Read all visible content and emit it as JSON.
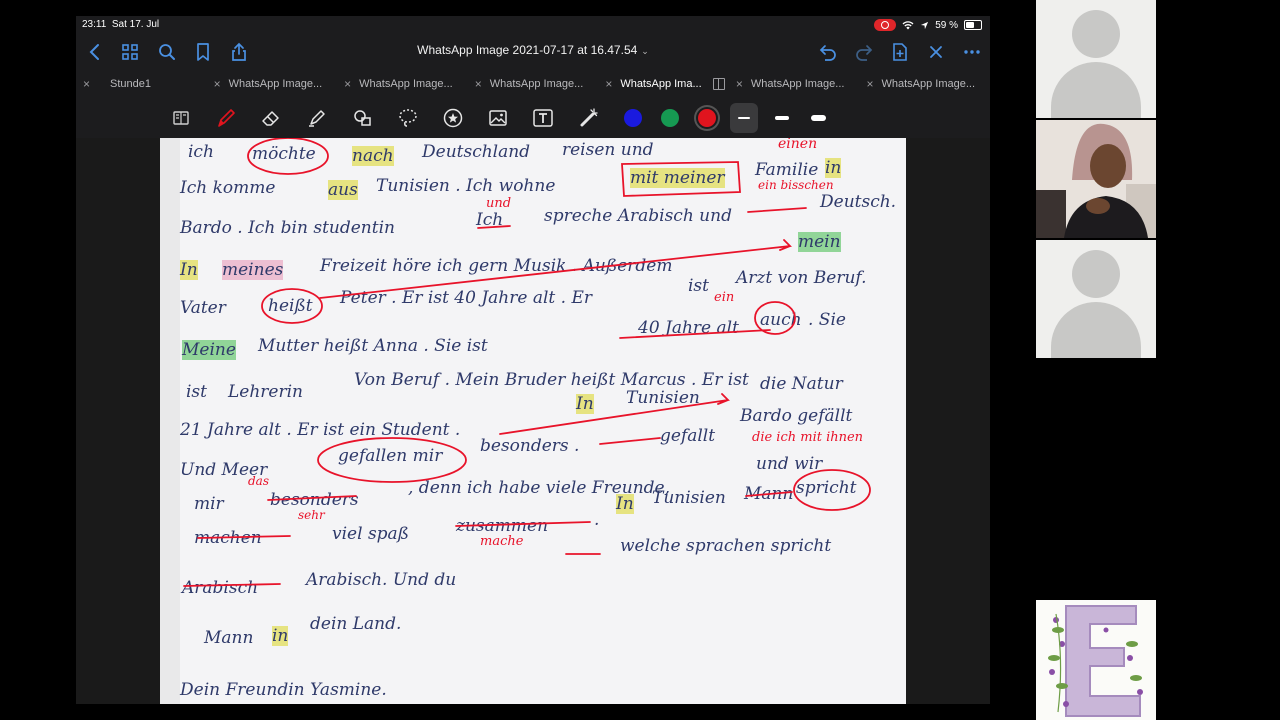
{
  "status_bar": {
    "time": "23:11",
    "date": "Sat 17. Jul",
    "battery": "59 %"
  },
  "navbar": {
    "title": "WhatsApp Image 2021-07-17 at 16.47.54"
  },
  "tabs": [
    {
      "label": "Stunde1",
      "active": false
    },
    {
      "label": "WhatsApp Image...",
      "active": false
    },
    {
      "label": "WhatsApp Image...",
      "active": false
    },
    {
      "label": "WhatsApp Image...",
      "active": false
    },
    {
      "label": "WhatsApp Ima...",
      "active": true
    },
    {
      "label": "WhatsApp Image...",
      "active": false
    },
    {
      "label": "WhatsApp Image...",
      "active": false
    }
  ],
  "toolbar": {
    "colors": [
      "#1a1adf",
      "#169a52",
      "#e0141e"
    ],
    "selected_color_index": 2
  },
  "handwriting": {
    "l1": "ich",
    "l1b": "möchte",
    "l1c": "nach",
    "l1d": "Deutschland",
    "l1e": "reisen und",
    "l1f": "einen",
    "l2": "Ich komme",
    "l2b": "aus",
    "l2c": "Tunisien . Ich wohne",
    "l2d": "mit meiner",
    "l2e": "Familie",
    "l2f": "in",
    "l2note": "ein bisschen",
    "l3": "Bardo . Ich bin studentin",
    "l3b": "Ich",
    "l3c": "spreche Arabisch und",
    "l3d": "Deutsch.",
    "l3note": "und",
    "l4": "In",
    "l4b": "meines",
    "l4c": "Freizeit   höre ich  gern Musik . Außerdem",
    "l4d": "mein",
    "l5": "Vater",
    "l5b": "heißt",
    "l5c": "Peter . Er ist 40 Jahre alt . Er",
    "l5d": "ist",
    "l5e": "Arzt von Beruf.",
    "l5note": "ein",
    "l6": "Meine",
    "l6b": "Mutter   heißt  Anna  . Sie ist",
    "l6c": "40 Jahre alt",
    "l6d": "auch",
    "l6e": ". Sie",
    "l7": "ist",
    "l7b": "Lehrerin",
    "l7c": "Von Beruf . Mein Bruder  heißt  Marcus . Er ist",
    "l8": "21 Jahre alt . Er ist ein Student .",
    "l8b": "In",
    "l8c": "Tunisien",
    "l8d": "die Natur",
    "l9": "Bardo gefällt",
    "l10": "Und Meer",
    "l10b": "gefallen mir",
    "l10c": "besonders .",
    "l10d": "gefallt",
    "l10note": "die ich mit ihnen",
    "l11": "mir",
    "l11b": "besonders",
    "l11c": ", denn   ich habe  viele Freunde,",
    "l11d": "und wir",
    "l11note": "das",
    "l11note2": "sehr",
    "l12": "In",
    "l12b": "Tunisien",
    "l12c": "Mann",
    "l12d": "spricht",
    "l13": "machen",
    "l13b": "viel spaß",
    "l13c": "zusammen",
    "l13d": ".",
    "l13note": "mache",
    "l14": "Arabisch",
    "l14b": "Arabisch.    Und du",
    "l14c": "welche  sprachen  spricht",
    "l15": "Mann",
    "l15b": "in",
    "l15c": "dein  Land.",
    "l16": "Dein   Freundin   Yasmine."
  }
}
